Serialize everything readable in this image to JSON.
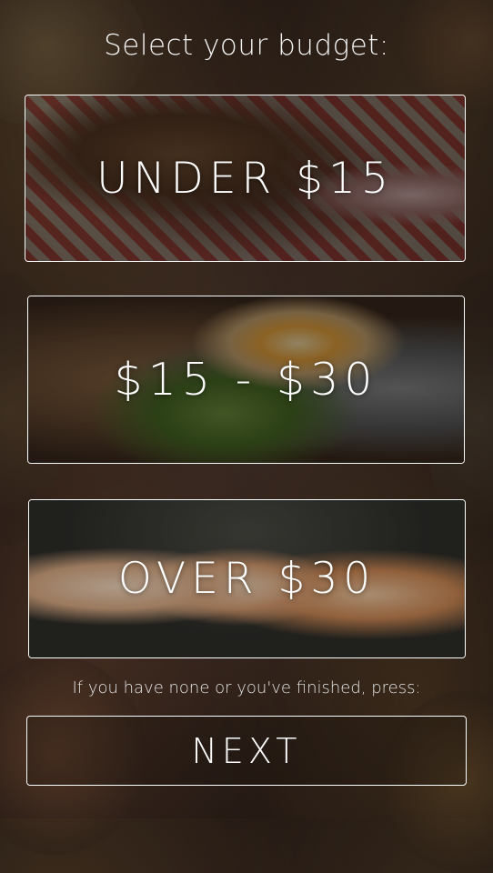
{
  "screen": {
    "title": "Select your budget:",
    "options": [
      {
        "label": "UNDER $15",
        "photo": "burrito-photo"
      },
      {
        "label": "$15 - $30",
        "photo": "ramen-photo"
      },
      {
        "label": "OVER $30",
        "photo": "sushi-photo"
      }
    ],
    "hint": "If you have none or you've finished, press:",
    "next_label": "NEXT"
  },
  "colors": {
    "border": "#ffffff",
    "text": "#ffffff",
    "background": "#241914"
  }
}
